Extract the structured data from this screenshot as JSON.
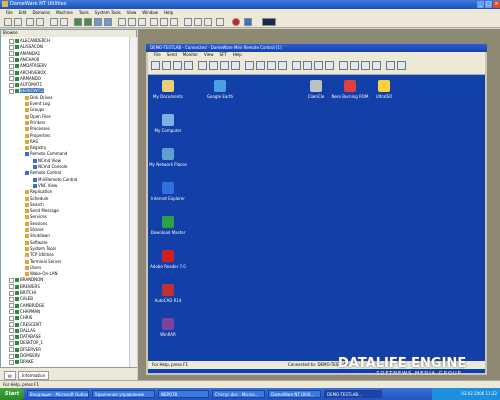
{
  "window": {
    "title": "DameWare NT Utilities"
  },
  "menu": [
    "File",
    "Edit",
    "Domains",
    "Machine",
    "Tools",
    "System Tools",
    "View",
    "Window",
    "Help"
  ],
  "tree": {
    "header": "Browse",
    "items": [
      {
        "label": "ALECANDERCH",
        "indent": 1,
        "icon": "green"
      },
      {
        "label": "ALISSACON",
        "indent": 1,
        "icon": "green"
      },
      {
        "label": "AMANDA1",
        "indent": 1,
        "icon": "green"
      },
      {
        "label": "ANCHA00",
        "indent": 1,
        "icon": "green"
      },
      {
        "label": "AMDATASERV",
        "indent": 1,
        "icon": "green"
      },
      {
        "label": "ARCHIVEBOX",
        "indent": 1,
        "icon": "green"
      },
      {
        "label": "ARMANDO",
        "indent": 1,
        "icon": "green"
      },
      {
        "label": "AUTOMAT1",
        "indent": 1,
        "icon": "green"
      },
      {
        "label": "BERKOWITZ",
        "indent": 1,
        "icon": "green",
        "selected": true
      },
      {
        "label": "Disk Drives",
        "indent": 3,
        "icon": "gold"
      },
      {
        "label": "Event Log",
        "indent": 3,
        "icon": "gold"
      },
      {
        "label": "Groups",
        "indent": 3,
        "icon": "gold"
      },
      {
        "label": "Open Files",
        "indent": 3,
        "icon": "gold"
      },
      {
        "label": "Printers",
        "indent": 3,
        "icon": "gold"
      },
      {
        "label": "Processes",
        "indent": 3,
        "icon": "gold"
      },
      {
        "label": "Properties",
        "indent": 3,
        "icon": "gold"
      },
      {
        "label": "RAS",
        "indent": 3,
        "icon": "gold"
      },
      {
        "label": "Registry",
        "indent": 3,
        "icon": "gold"
      },
      {
        "label": "Remote Command",
        "indent": 3,
        "icon": "blue"
      },
      {
        "label": "NCmd View",
        "indent": 4,
        "icon": "blue"
      },
      {
        "label": "NCmd Console",
        "indent": 4,
        "icon": "blue"
      },
      {
        "label": "Remote Control",
        "indent": 3,
        "icon": "blue"
      },
      {
        "label": "MiniRemote Control",
        "indent": 4,
        "icon": "blue"
      },
      {
        "label": "VNC View",
        "indent": 4,
        "icon": "blue"
      },
      {
        "label": "Replication",
        "indent": 3,
        "icon": "gold"
      },
      {
        "label": "Schedule",
        "indent": 3,
        "icon": "gold"
      },
      {
        "label": "Search",
        "indent": 3,
        "icon": "gold"
      },
      {
        "label": "Send Message",
        "indent": 3,
        "icon": "gold"
      },
      {
        "label": "Services",
        "indent": 3,
        "icon": "gold"
      },
      {
        "label": "Sessions",
        "indent": 3,
        "icon": "gold"
      },
      {
        "label": "Shares",
        "indent": 3,
        "icon": "gold"
      },
      {
        "label": "Shutdown",
        "indent": 3,
        "icon": "gold"
      },
      {
        "label": "Software",
        "indent": 3,
        "icon": "gold"
      },
      {
        "label": "System Tools",
        "indent": 3,
        "icon": "gold"
      },
      {
        "label": "TCP Utilities",
        "indent": 3,
        "icon": "gold"
      },
      {
        "label": "Terminal Server",
        "indent": 3,
        "icon": "gold"
      },
      {
        "label": "Users",
        "indent": 3,
        "icon": "gold"
      },
      {
        "label": "Wake-On-LAN",
        "indent": 3,
        "icon": "gold"
      },
      {
        "label": "BRANDNON",
        "indent": 1,
        "icon": "green"
      },
      {
        "label": "BREWERS",
        "indent": 1,
        "icon": "green"
      },
      {
        "label": "BRITCHI",
        "indent": 1,
        "icon": "green"
      },
      {
        "label": "CALEB",
        "indent": 1,
        "icon": "green"
      },
      {
        "label": "CAMBRIDGE",
        "indent": 1,
        "icon": "green"
      },
      {
        "label": "CHAPMAN",
        "indent": 1,
        "icon": "green"
      },
      {
        "label": "CHRIS",
        "indent": 1,
        "icon": "green"
      },
      {
        "label": "CRESCENT",
        "indent": 1,
        "icon": "green"
      },
      {
        "label": "DALLAS",
        "indent": 1,
        "icon": "green"
      },
      {
        "label": "DATABASE",
        "indent": 1,
        "icon": "green"
      },
      {
        "label": "DESKTOP_1",
        "indent": 1,
        "icon": "green"
      },
      {
        "label": "DFSERVER",
        "indent": 1,
        "icon": "green"
      },
      {
        "label": "DOMSERV",
        "indent": 1,
        "icon": "green"
      },
      {
        "label": "DRAKE",
        "indent": 1,
        "icon": "green"
      }
    ],
    "footer_tab": "Information"
  },
  "remote": {
    "title": "DEMO-TESTLAB - Connected - DameWare Mini Remote Control [1]",
    "menu": [
      "File",
      "Send",
      "Monitor",
      "View",
      "SFT",
      "Help"
    ],
    "desktop_icons": [
      {
        "label": "My Documents",
        "color": "#e8d07a",
        "col": 0,
        "row": 0
      },
      {
        "label": "Google Earth",
        "color": "#4aa0e0",
        "col": 1,
        "row": 0
      },
      {
        "label": "ClamCle",
        "color": "#c0c0c0",
        "col": 3,
        "row": 0
      },
      {
        "label": "Nero Burning ROM",
        "color": "#e04040",
        "col": 4,
        "row": 0
      },
      {
        "label": "UltraISO",
        "color": "#ffd040",
        "col": 5,
        "row": 0
      },
      {
        "label": "My Computer",
        "color": "#7fb0e0",
        "col": 0,
        "row": 1
      },
      {
        "label": "My Network Places",
        "color": "#5fa0d0",
        "col": 0,
        "row": 2
      },
      {
        "label": "Internet Explorer",
        "color": "#3070e0",
        "col": 0,
        "row": 3
      },
      {
        "label": "Download Master",
        "color": "#30a040",
        "col": 0,
        "row": 4
      },
      {
        "label": "Adobe Reader 7.0",
        "color": "#d02020",
        "col": 0,
        "row": 5
      },
      {
        "label": "AutoCAD R14",
        "color": "#c03030",
        "col": 0,
        "row": 6
      },
      {
        "label": "WinRAR",
        "color": "#8040a0",
        "col": 0,
        "row": 7
      }
    ],
    "status_left": "For Help, press F1",
    "status_mid": "Connected to: DEMO-TESTLAB"
  },
  "app_status": "For Help, press F1",
  "taskbar": {
    "start": "Start",
    "tasks": [
      "Входящие - Microsoft Outlook",
      "Удаленное управление",
      "NEPO78",
      "Статус.doc - Micros...",
      "DameWare NT Utilit...",
      "DEMO-TESTLAB..."
    ],
    "clock": "03.02.2006 11:22"
  },
  "watermark": {
    "big": "DATALIFE ENGINE",
    "small": "SOFTNEWS MEDIA GROUP"
  }
}
